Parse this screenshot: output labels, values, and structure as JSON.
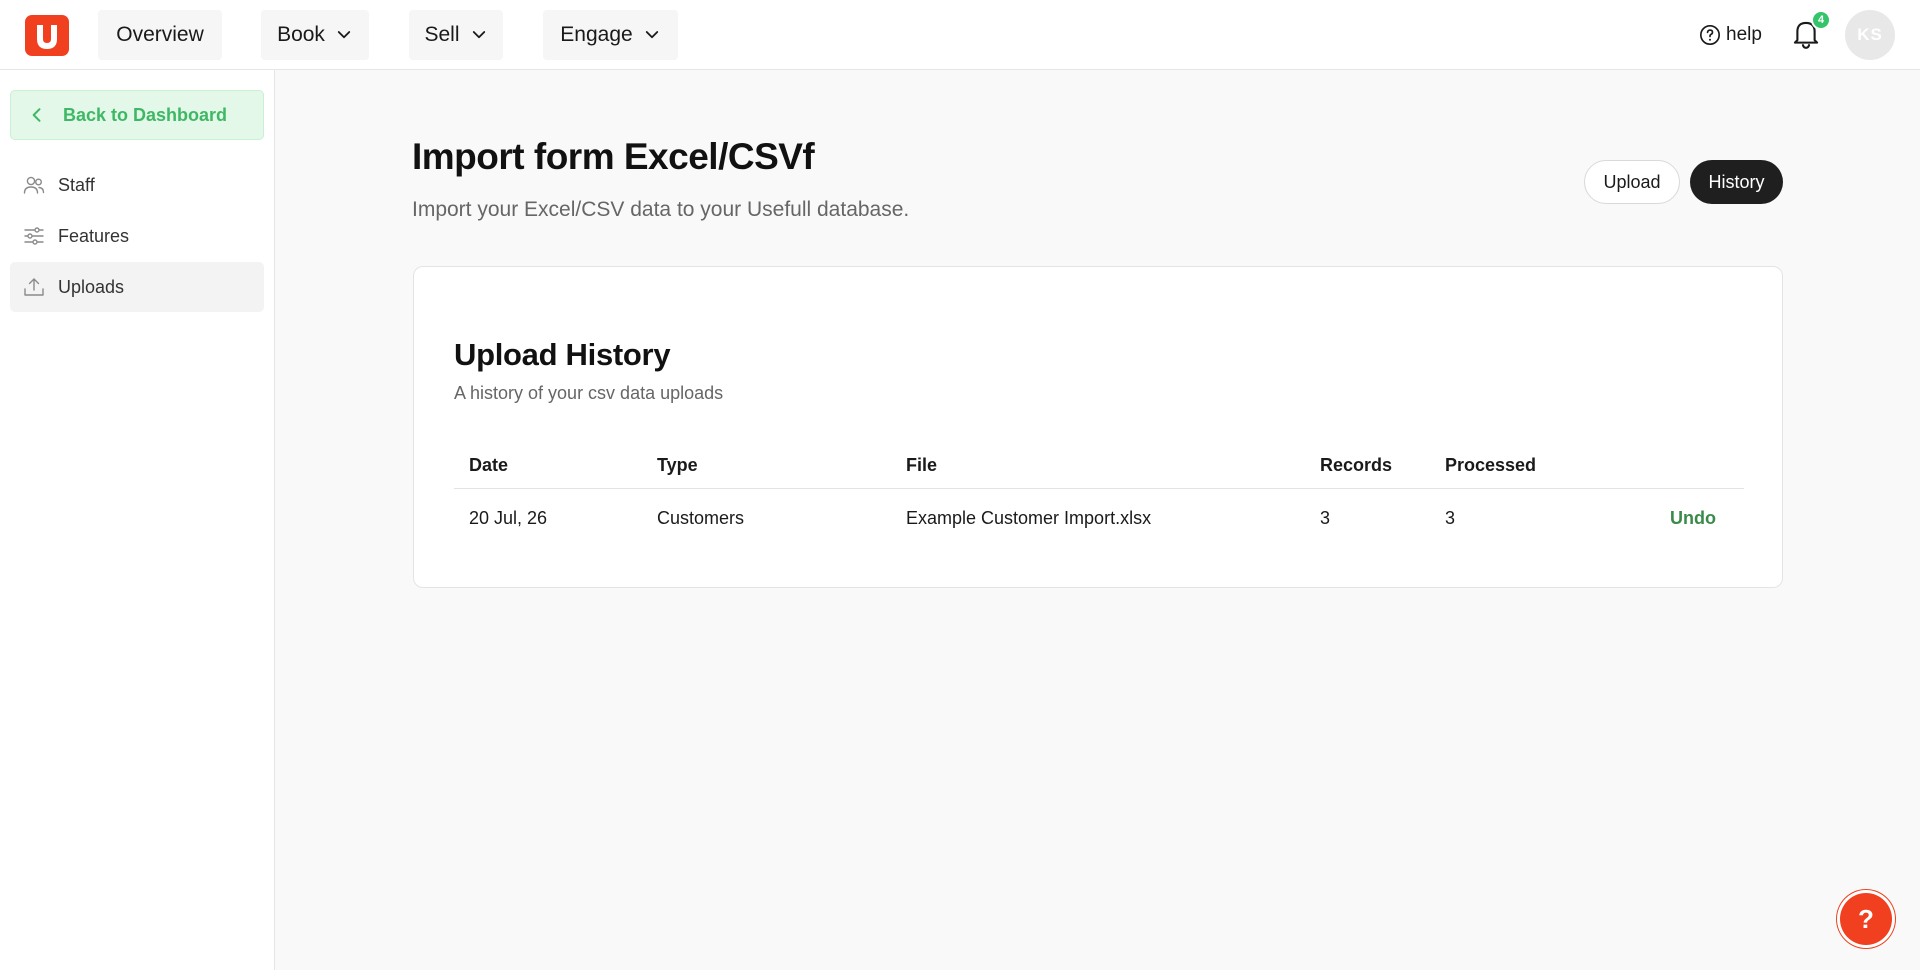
{
  "nav": {
    "overview": "Overview",
    "book": "Book",
    "sell": "Sell",
    "engage": "Engage",
    "help": "help",
    "notification_count": "4",
    "avatar_initials": "KS"
  },
  "sidebar": {
    "back_label": "Back to Dashboard",
    "items": [
      {
        "label": "Staff",
        "icon": "users-icon"
      },
      {
        "label": "Features",
        "icon": "sliders-icon"
      },
      {
        "label": "Uploads",
        "icon": "upload-icon",
        "active": true
      }
    ]
  },
  "main": {
    "title": "Import form Excel/CSVf",
    "subtitle": "Import your Excel/CSV data to your Usefull database.",
    "toggle": {
      "upload": "Upload",
      "history": "History",
      "selected": "History"
    }
  },
  "history": {
    "title": "Upload History",
    "subtitle": "A history of your csv data uploads",
    "columns": [
      "Date",
      "Type",
      "File",
      "Records",
      "Processed"
    ],
    "rows": [
      {
        "date": "20 Jul, 26",
        "type": "Customers",
        "file": "Example Customer Import.xlsx",
        "records": "3",
        "processed": "3",
        "action": "Undo"
      }
    ]
  },
  "fab": {
    "label": "?"
  },
  "colors": {
    "brand": "#f0401f",
    "accent_green": "#3fb865",
    "badge_green": "#35c46a",
    "dark_button": "#1f1f1f"
  }
}
